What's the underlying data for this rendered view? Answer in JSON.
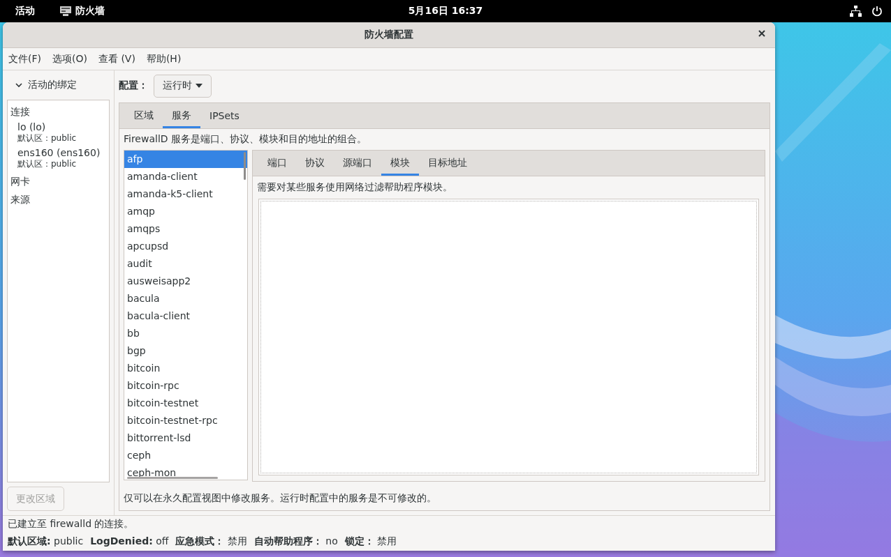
{
  "top_bar": {
    "activities": "活动",
    "app_name": "防火墙",
    "clock": "5月16日 16:37"
  },
  "window": {
    "title": "防火墙配置"
  },
  "menu": [
    "文件(F)",
    "选项(O)",
    "查看 (V)",
    "帮助(H)"
  ],
  "sidebar": {
    "header": "活动的绑定",
    "expanded": true,
    "groups": [
      {
        "label": "连接",
        "children": [
          {
            "name": "lo (lo)",
            "zone": "默认区：public"
          },
          {
            "name": "ens160 (ens160)",
            "zone": "默认区：public"
          }
        ]
      },
      {
        "label": "网卡"
      },
      {
        "label": "来源"
      }
    ],
    "change_zone_button": {
      "label": "更改区域",
      "disabled": true
    }
  },
  "config": {
    "label": "配置：",
    "value": "运行时"
  },
  "tabs": [
    {
      "label": "区域",
      "selected": false
    },
    {
      "label": "服务",
      "selected": true
    },
    {
      "label": "IPSets",
      "selected": false
    }
  ],
  "description": "FirewallD 服务是端口、协议、模块和目的地址的组合。",
  "services": [
    {
      "name": "afp",
      "selected": true
    },
    {
      "name": "amanda-client",
      "selected": false
    },
    {
      "name": "amanda-k5-client",
      "selected": false
    },
    {
      "name": "amqp",
      "selected": false
    },
    {
      "name": "amqps",
      "selected": false
    },
    {
      "name": "apcupsd",
      "selected": false
    },
    {
      "name": "audit",
      "selected": false
    },
    {
      "name": "ausweisapp2",
      "selected": false
    },
    {
      "name": "bacula",
      "selected": false
    },
    {
      "name": "bacula-client",
      "selected": false
    },
    {
      "name": "bb",
      "selected": false
    },
    {
      "name": "bgp",
      "selected": false
    },
    {
      "name": "bitcoin",
      "selected": false
    },
    {
      "name": "bitcoin-rpc",
      "selected": false
    },
    {
      "name": "bitcoin-testnet",
      "selected": false
    },
    {
      "name": "bitcoin-testnet-rpc",
      "selected": false
    },
    {
      "name": "bittorrent-lsd",
      "selected": false
    },
    {
      "name": "ceph",
      "selected": false
    },
    {
      "name": "ceph-mon",
      "selected": false
    }
  ],
  "service_tabs": [
    {
      "label": "端口",
      "selected": false
    },
    {
      "label": "协议",
      "selected": false
    },
    {
      "label": "源端口",
      "selected": false
    },
    {
      "label": "模块",
      "selected": true
    },
    {
      "label": "目标地址",
      "selected": false
    }
  ],
  "module_description": "需要对某些服务使用网络过滤帮助程序模块。",
  "footer_note": "仅可以在永久配置视图中修改服务。运行时配置中的服务是不可修改的。",
  "status_bar": {
    "message": "已建立至 firewalld 的连接。",
    "items": [
      {
        "label": "默认区域:",
        "value": "public"
      },
      {
        "label": "LogDenied:",
        "value": "off"
      },
      {
        "label": "应急模式：",
        "value": "禁用"
      },
      {
        "label": "自动帮助程序：",
        "value": "no"
      },
      {
        "label": "锁定：",
        "value": "禁用"
      }
    ]
  }
}
